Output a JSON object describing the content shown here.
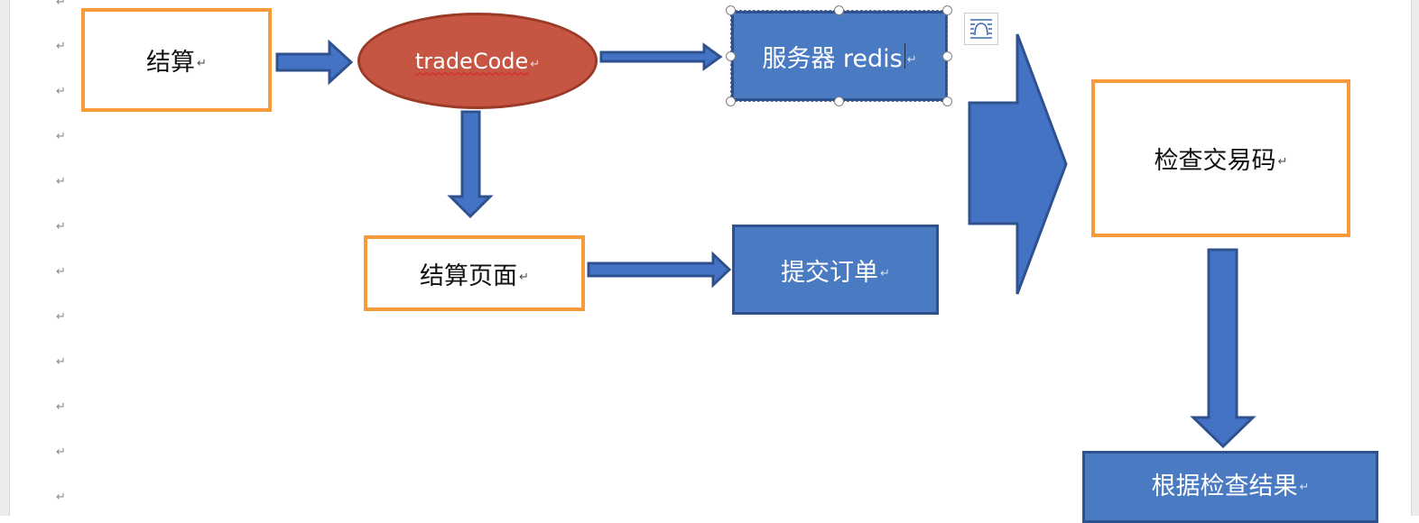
{
  "paragraph_mark": "↵",
  "nodes": {
    "checkout": {
      "label": "结算"
    },
    "trade_code": {
      "label": "tradeCode"
    },
    "server_redis": {
      "label": "服务器 redis"
    },
    "checkout_page": {
      "label": "结算页面"
    },
    "submit_order": {
      "label": "提交订单"
    },
    "check_trade_code": {
      "label": "检查交易码"
    },
    "by_check_result": {
      "label": "根据检查结果"
    }
  },
  "colors": {
    "orange_border": "#f79a3a",
    "blue_fill": "#4a7bc2",
    "blue_border": "#2f528f",
    "red_fill": "#c65544",
    "red_border": "#9c3a28",
    "arrow_fill": "#4472c4",
    "arrow_border": "#2f528f"
  },
  "selected_node": "server_redis",
  "icons": {
    "layout_options": "layout-options-icon"
  }
}
